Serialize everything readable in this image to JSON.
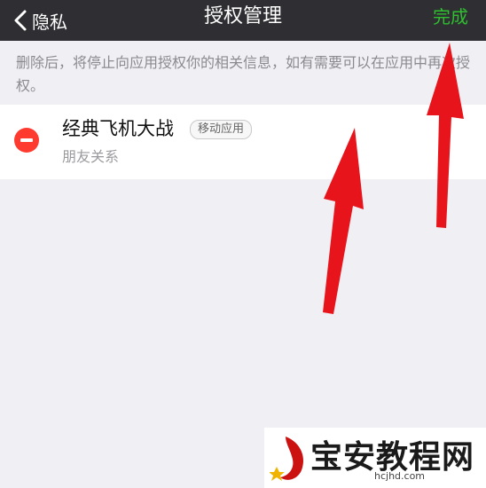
{
  "navbar": {
    "back_label": "隐私",
    "title": "授权管理",
    "done_label": "完成"
  },
  "notice": "删除后，将停止向应用授权你的相关信息，如有需要可以在应用中再次授权。",
  "apps": [
    {
      "name": "经典飞机大战",
      "tag": "移动应用",
      "permission": "朋友关系"
    }
  ],
  "watermark": {
    "title": "宝安教程网",
    "url": "hcjhd.com"
  },
  "colors": {
    "navbar_bg": "#2e2e33",
    "done": "#2fbf2f",
    "delete": "#ff3b30",
    "arrow": "#e8141b"
  }
}
